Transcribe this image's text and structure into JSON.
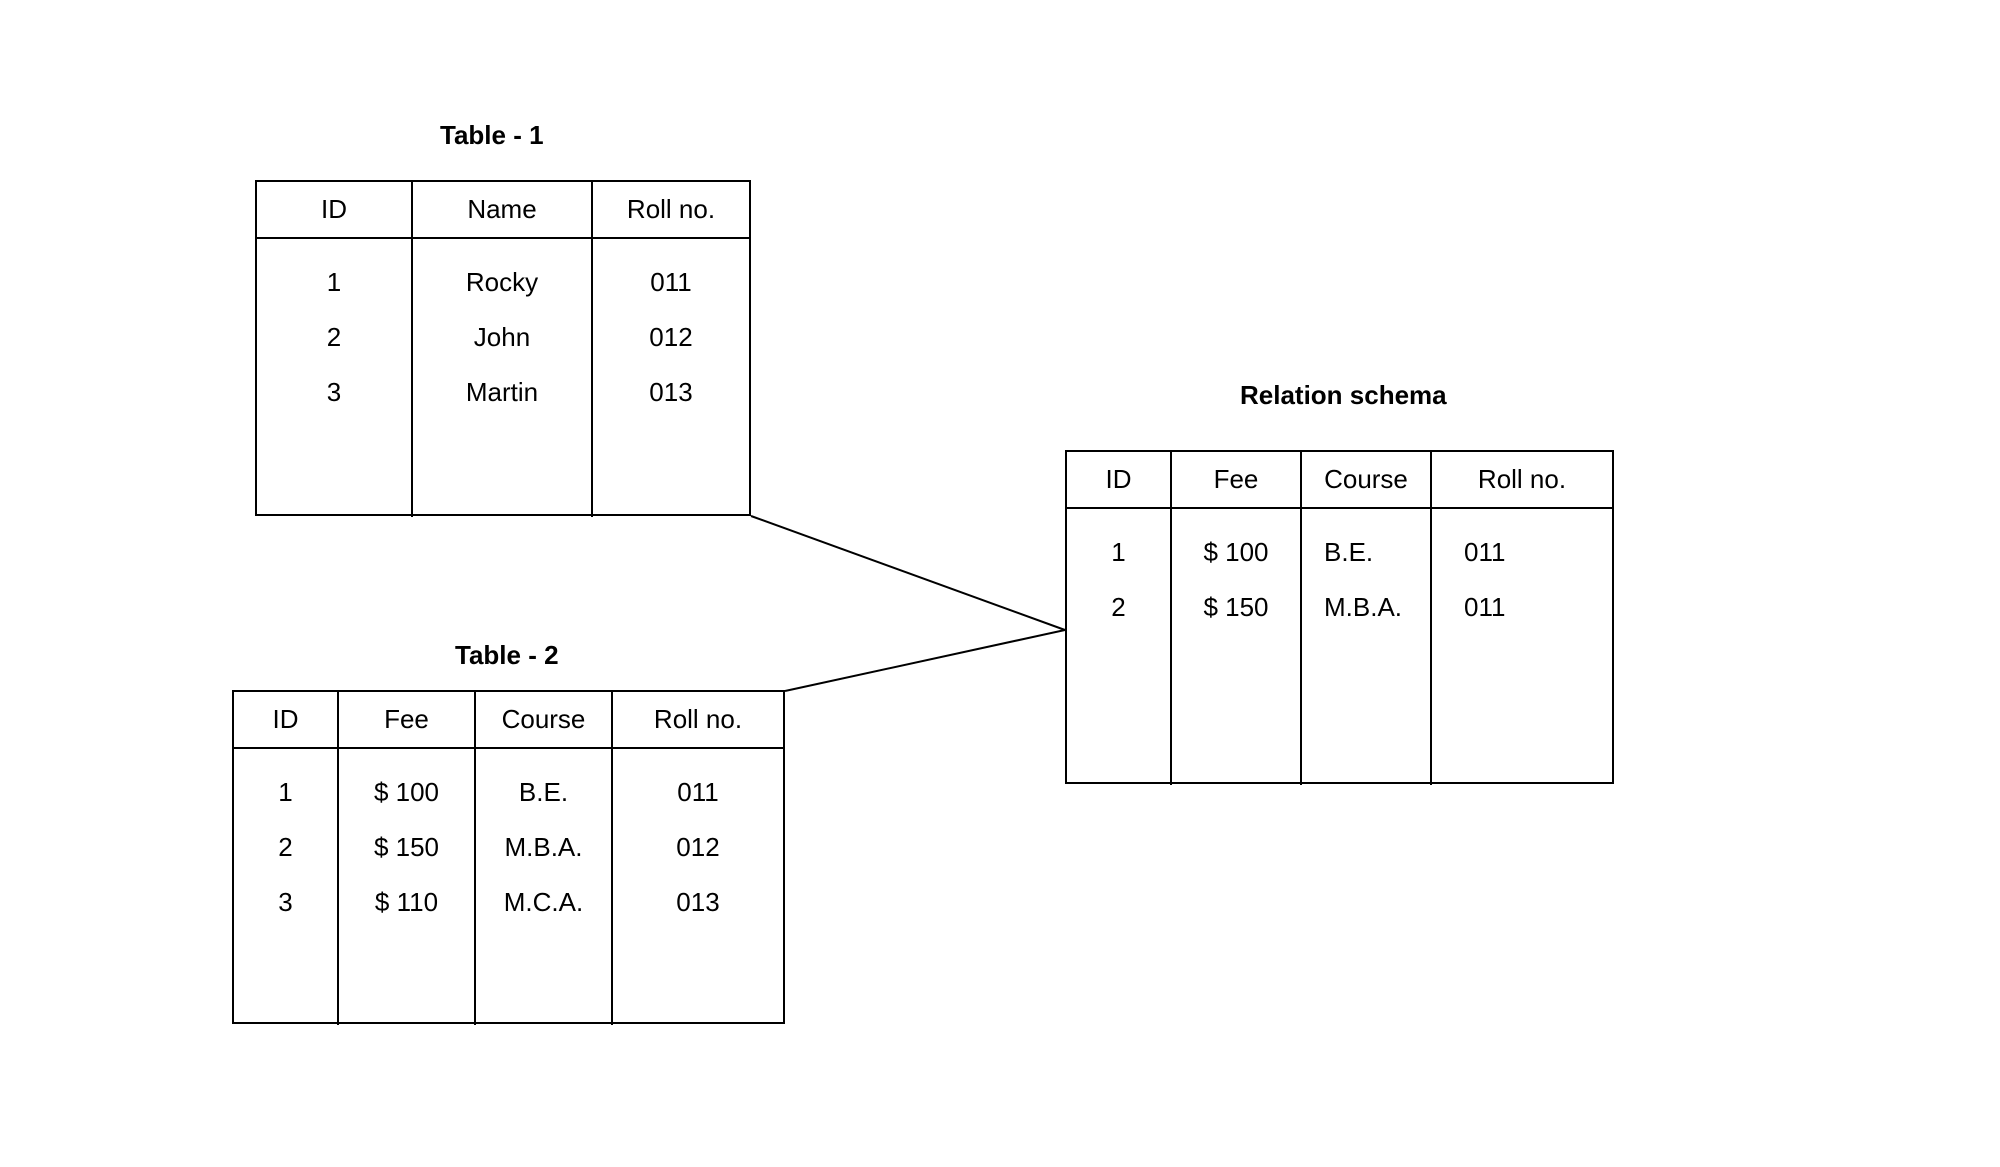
{
  "table1": {
    "title": "Table - 1",
    "headers": [
      "ID",
      "Name",
      "Roll no."
    ],
    "rows": [
      [
        "1",
        "Rocky",
        "011"
      ],
      [
        "2",
        "John",
        "012"
      ],
      [
        "3",
        "Martin",
        "013"
      ]
    ]
  },
  "table2": {
    "title": "Table - 2",
    "headers": [
      "ID",
      "Fee",
      "Course",
      "Roll no."
    ],
    "rows": [
      [
        "1",
        "$ 100",
        "B.E.",
        "011"
      ],
      [
        "2",
        "$ 150",
        "M.B.A.",
        "012"
      ],
      [
        "3",
        "$ 110",
        "M.C.A.",
        "013"
      ]
    ]
  },
  "schema": {
    "title": "Relation schema",
    "headers": [
      "ID",
      "Fee",
      "Course",
      "Roll no."
    ],
    "rows": [
      [
        "1",
        "$ 100",
        "B.E.",
        "011"
      ],
      [
        "2",
        "$ 150",
        "M.B.A.",
        "011"
      ]
    ]
  }
}
